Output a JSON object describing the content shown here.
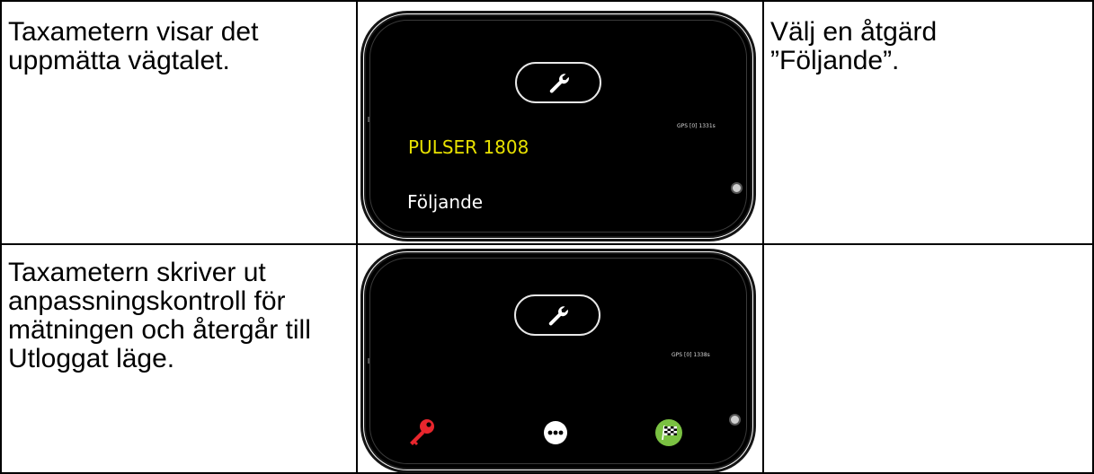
{
  "rows": [
    {
      "description": "Taxametern visar det\nuppmätta vägtalet.",
      "screen": {
        "gps_text": "GPS [0] 1331s",
        "pulser_text": "PULSER 1808",
        "option_text": "Följande"
      },
      "instruction": "Välj en åtgärd\n”Följande”."
    },
    {
      "description": "Taxametern skriver ut\nanpassningskontroll för\nmätningen och återgår till\nUtloggat läge.",
      "screen": {
        "gps_text": "GPS [0] 1338s",
        "icons": [
          "key-icon",
          "more-icon",
          "checkered-flag-icon"
        ]
      },
      "instruction": ""
    }
  ],
  "colors": {
    "pulser": "#e8e100",
    "key": "#e8262d",
    "flag_circle": "#7ac142"
  }
}
